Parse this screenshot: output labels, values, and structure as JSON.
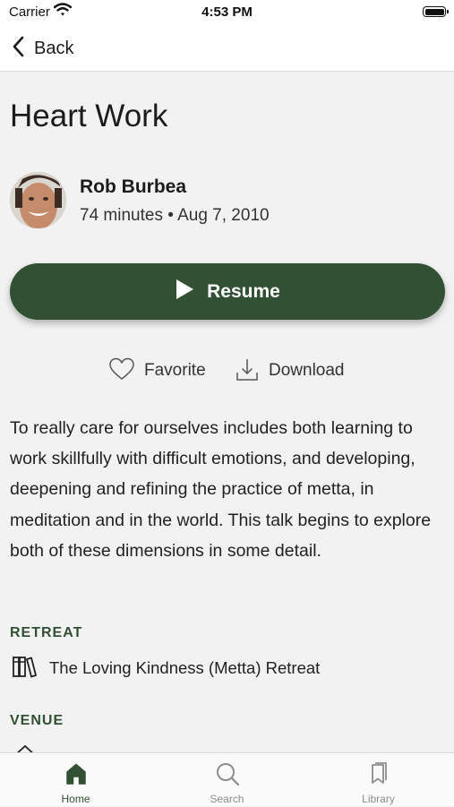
{
  "status_bar": {
    "carrier": "Carrier",
    "time": "4:53 PM"
  },
  "nav": {
    "back_label": "Back"
  },
  "talk": {
    "title": "Heart Work",
    "speaker": "Rob Burbea",
    "meta": "74 minutes • Aug 7, 2010",
    "resume_label": "Resume",
    "favorite_label": "Favorite",
    "download_label": "Download",
    "description": "To really care for ourselves includes both learning to work skillfully with difficult emotions, and developing, deepening and refining the practice of metta, in meditation and in the world.  This talk begins to explore both of these dimensions in some detail."
  },
  "retreat": {
    "header": "RETREAT",
    "name": "The Loving Kindness (Metta) Retreat"
  },
  "venue": {
    "header": "VENUE"
  },
  "tabs": [
    {
      "label": "Home",
      "icon": "home-icon",
      "active": true
    },
    {
      "label": "Search",
      "icon": "search-icon",
      "active": false
    },
    {
      "label": "Library",
      "icon": "library-icon",
      "active": false
    }
  ],
  "colors": {
    "accent": "#325033",
    "tab_inactive": "#8e8e8e",
    "background": "#f2f2f2"
  }
}
